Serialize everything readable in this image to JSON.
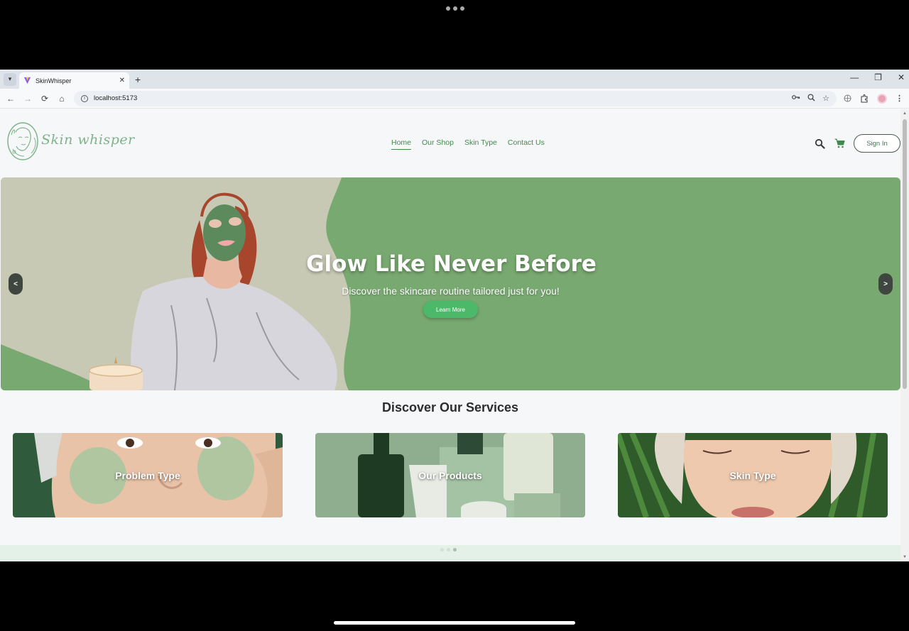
{
  "browser": {
    "tab_title": "SkinWhisper",
    "tab_close": "✕",
    "new_tab": "+",
    "url": "localhost:5173",
    "window_controls": {
      "minimize": "—",
      "restore": "❐",
      "close": "✕"
    },
    "nav": {
      "back": "←",
      "forward": "→",
      "reload": "⟳",
      "home": "⌂"
    }
  },
  "site": {
    "logo_text": "Skin whisper",
    "nav": [
      {
        "label": "Home",
        "active": true
      },
      {
        "label": "Our Shop",
        "active": false
      },
      {
        "label": "Skin Type",
        "active": false
      },
      {
        "label": "Contact Us",
        "active": false
      }
    ],
    "signin_label": "Sign In"
  },
  "hero": {
    "title": "Glow Like Never Before",
    "subtitle": "Discover the skincare routine tailored just for you!",
    "cta": "Learn More",
    "prev": "<",
    "next": ">"
  },
  "services": {
    "title": "Discover Our Services",
    "cards": [
      {
        "label": "Problem Type"
      },
      {
        "label": "Our Products"
      },
      {
        "label": "Skin Type"
      }
    ]
  },
  "colors": {
    "accent": "#3e8a4c",
    "hero_bg": "#78a970",
    "cta": "#4cb86a"
  }
}
